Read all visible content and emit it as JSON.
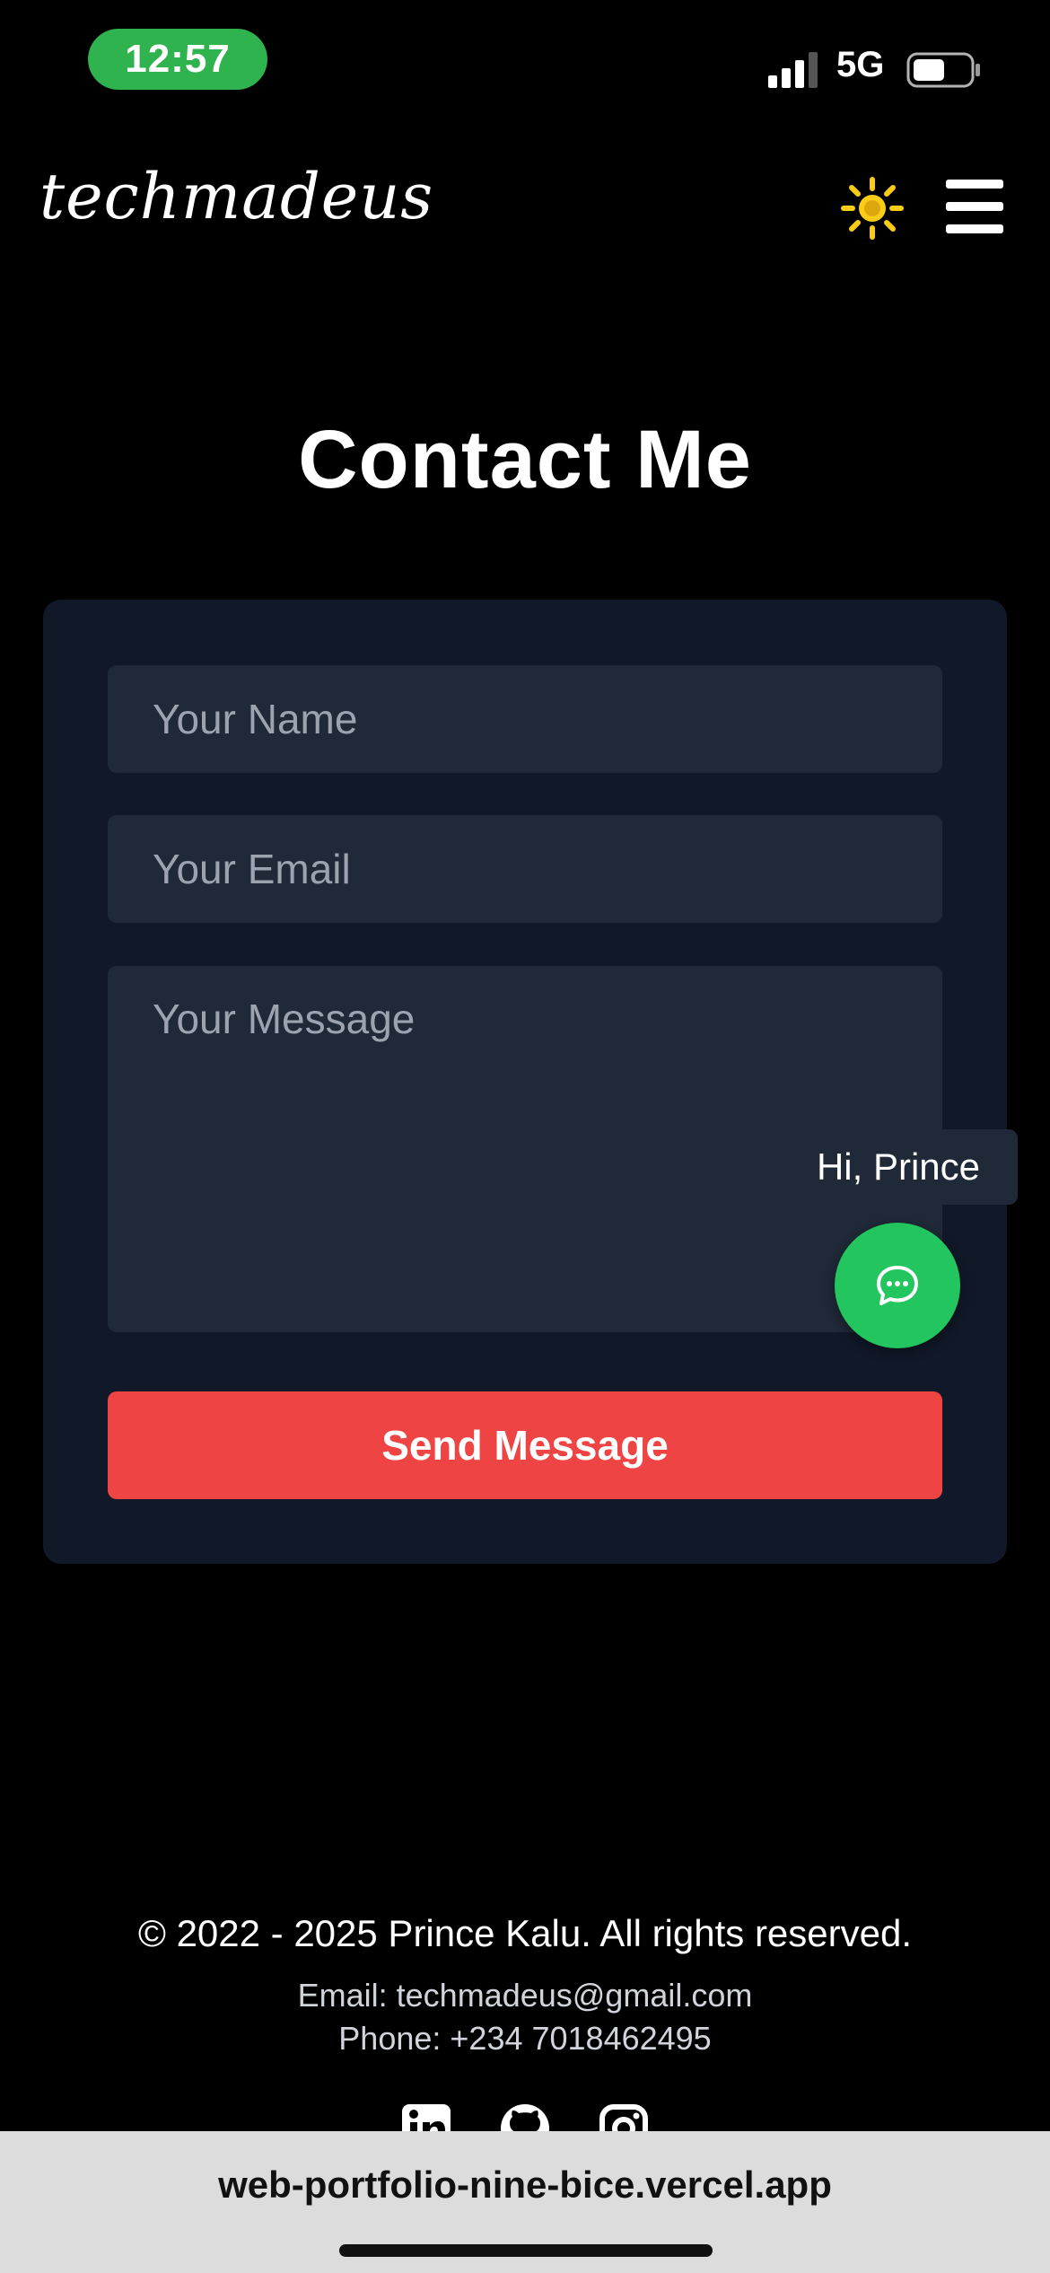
{
  "status_bar": {
    "time": "12:57",
    "network": "5G",
    "icons": [
      "signal-icon",
      "battery-icon"
    ]
  },
  "header": {
    "logo": "techmadeus",
    "icons": [
      "sun-icon",
      "hamburger-menu-icon"
    ],
    "accent_color": "#facc15"
  },
  "page": {
    "title": "Contact Me"
  },
  "form": {
    "name_placeholder": "Your Name",
    "email_placeholder": "Your Email",
    "message_placeholder": "Your Message",
    "send_label": "Send Message",
    "send_color": "#ef4444"
  },
  "chat": {
    "greeting": "Hi, Prince",
    "icon": "chat-bubble-icon",
    "color": "#22c55e"
  },
  "footer": {
    "copyright": "© 2022 - 2025 Prince Kalu. All rights reserved.",
    "email": "Email: techmadeus@gmail.com",
    "phone": "Phone: +234 7018462495",
    "social_icons": [
      "linkedin-icon",
      "github-icon",
      "instagram-icon"
    ]
  },
  "browser": {
    "url": "web-portfolio-nine-bice.vercel.app"
  }
}
